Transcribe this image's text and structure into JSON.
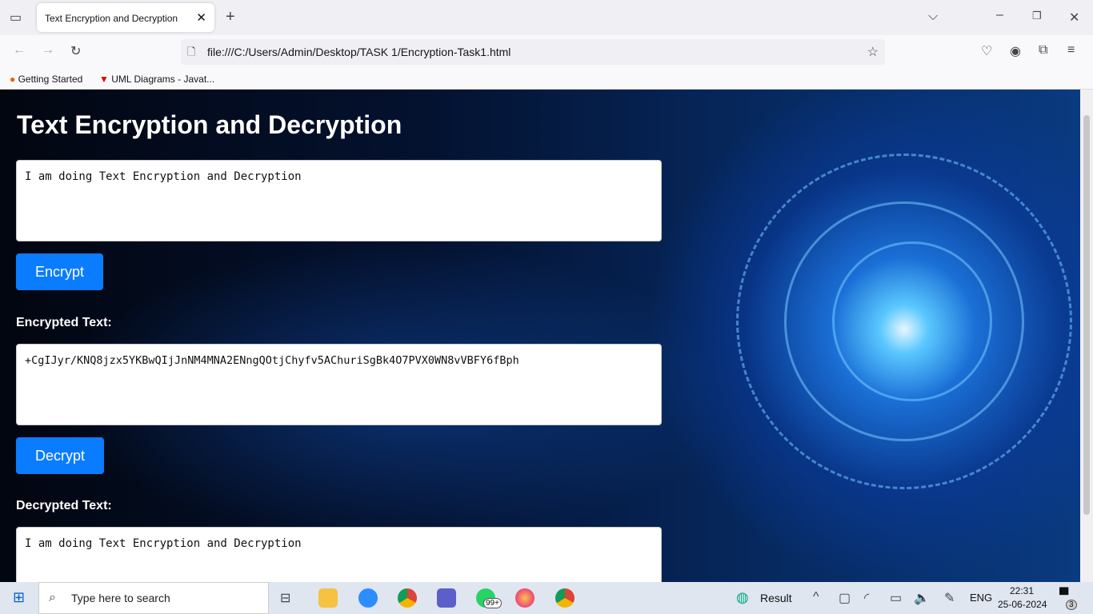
{
  "browser": {
    "tab_title": "Text Encryption and Decryption",
    "url": "file:///C:/Users/Admin/Desktop/TASK 1/Encryption-Task1.html",
    "bookmarks": [
      "Getting Started",
      "UML Diagrams - Javat..."
    ]
  },
  "page": {
    "title": "Text Encryption and Decryption",
    "input_text": "I am doing Text Encryption and Decryption",
    "encrypt_label": "Encrypt",
    "encrypted_label": "Encrypted Text:",
    "encrypted_text": "+CgIJyr/KNQ8jzx5YKBwQIjJnNM4MNA2ENngQOtjChyfv5AChuriSgBk4O7PVX0WN8vVBFY6fBph",
    "decrypt_label": "Decrypt",
    "decrypted_label": "Decrypted Text:",
    "decrypted_text": "I am doing Text Encryption and Decryption"
  },
  "taskbar": {
    "search_placeholder": "Type here to search",
    "whatsapp_badge": "99+",
    "weather_label": "Result",
    "lang": "ENG",
    "time": "22:31",
    "date": "25-06-2024",
    "notifications": "3"
  }
}
